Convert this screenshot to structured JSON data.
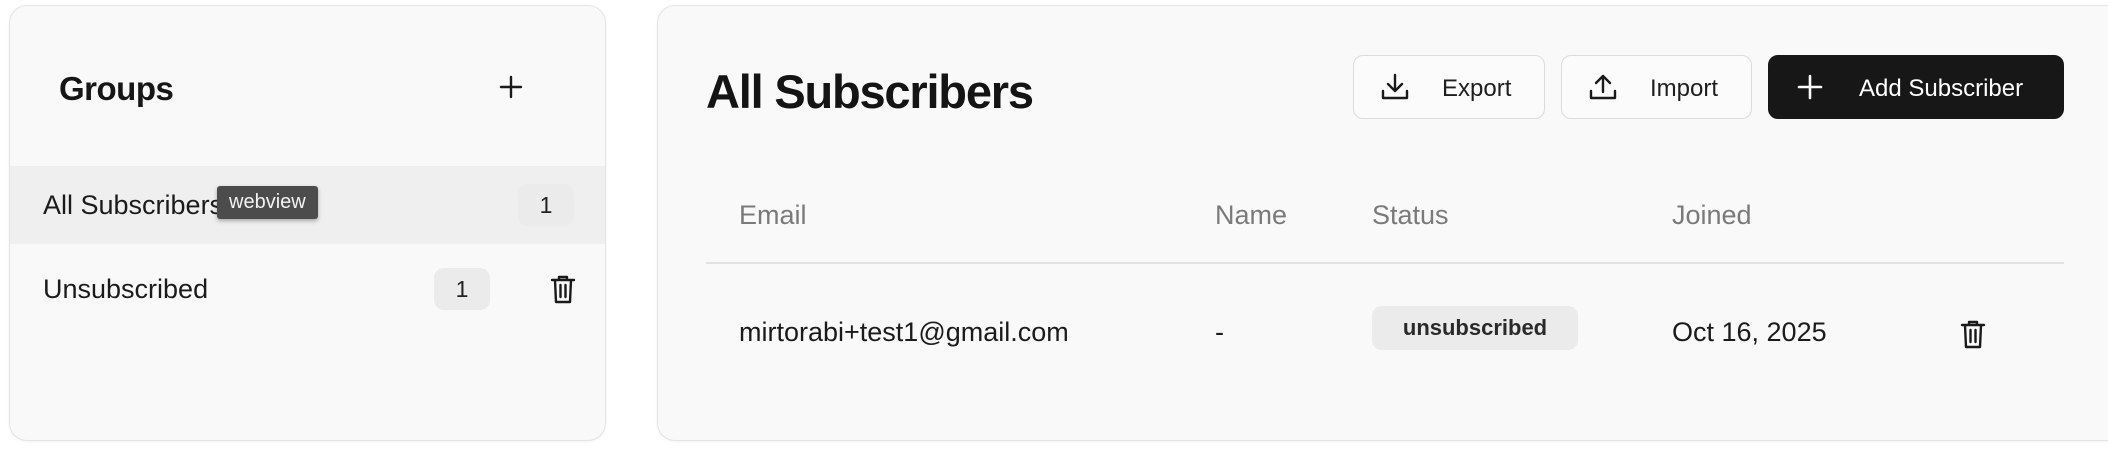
{
  "groups": {
    "title": "Groups",
    "add_icon": "plus-icon",
    "items": [
      {
        "label": "All Subscribers",
        "count": "1",
        "active": true
      },
      {
        "label": "Unsubscribed",
        "count": "1",
        "active": false,
        "delete_icon": "trash-icon"
      }
    ],
    "tooltip": "webview"
  },
  "subscribers": {
    "title": "All Subscribers",
    "buttons": {
      "export": {
        "label": "Export",
        "icon": "download-icon"
      },
      "import": {
        "label": "Import",
        "icon": "upload-icon"
      },
      "add": {
        "label": "Add Subscriber",
        "icon": "plus-icon"
      }
    },
    "columns": [
      "Email",
      "Name",
      "Status",
      "Joined"
    ],
    "rows": [
      {
        "email": "mirtorabi+test1@gmail.com",
        "name": "-",
        "status": "unsubscribed",
        "joined": "Oct 16, 2025",
        "delete_icon": "trash-icon"
      }
    ]
  },
  "colors": {
    "card_bg": "#f9f9f9",
    "active_row": "#efefef",
    "badge_bg": "#ebebeb",
    "primary_button": "#171717",
    "header_text": "#7a7a7a",
    "tooltip_bg": "#4c4c4c"
  }
}
